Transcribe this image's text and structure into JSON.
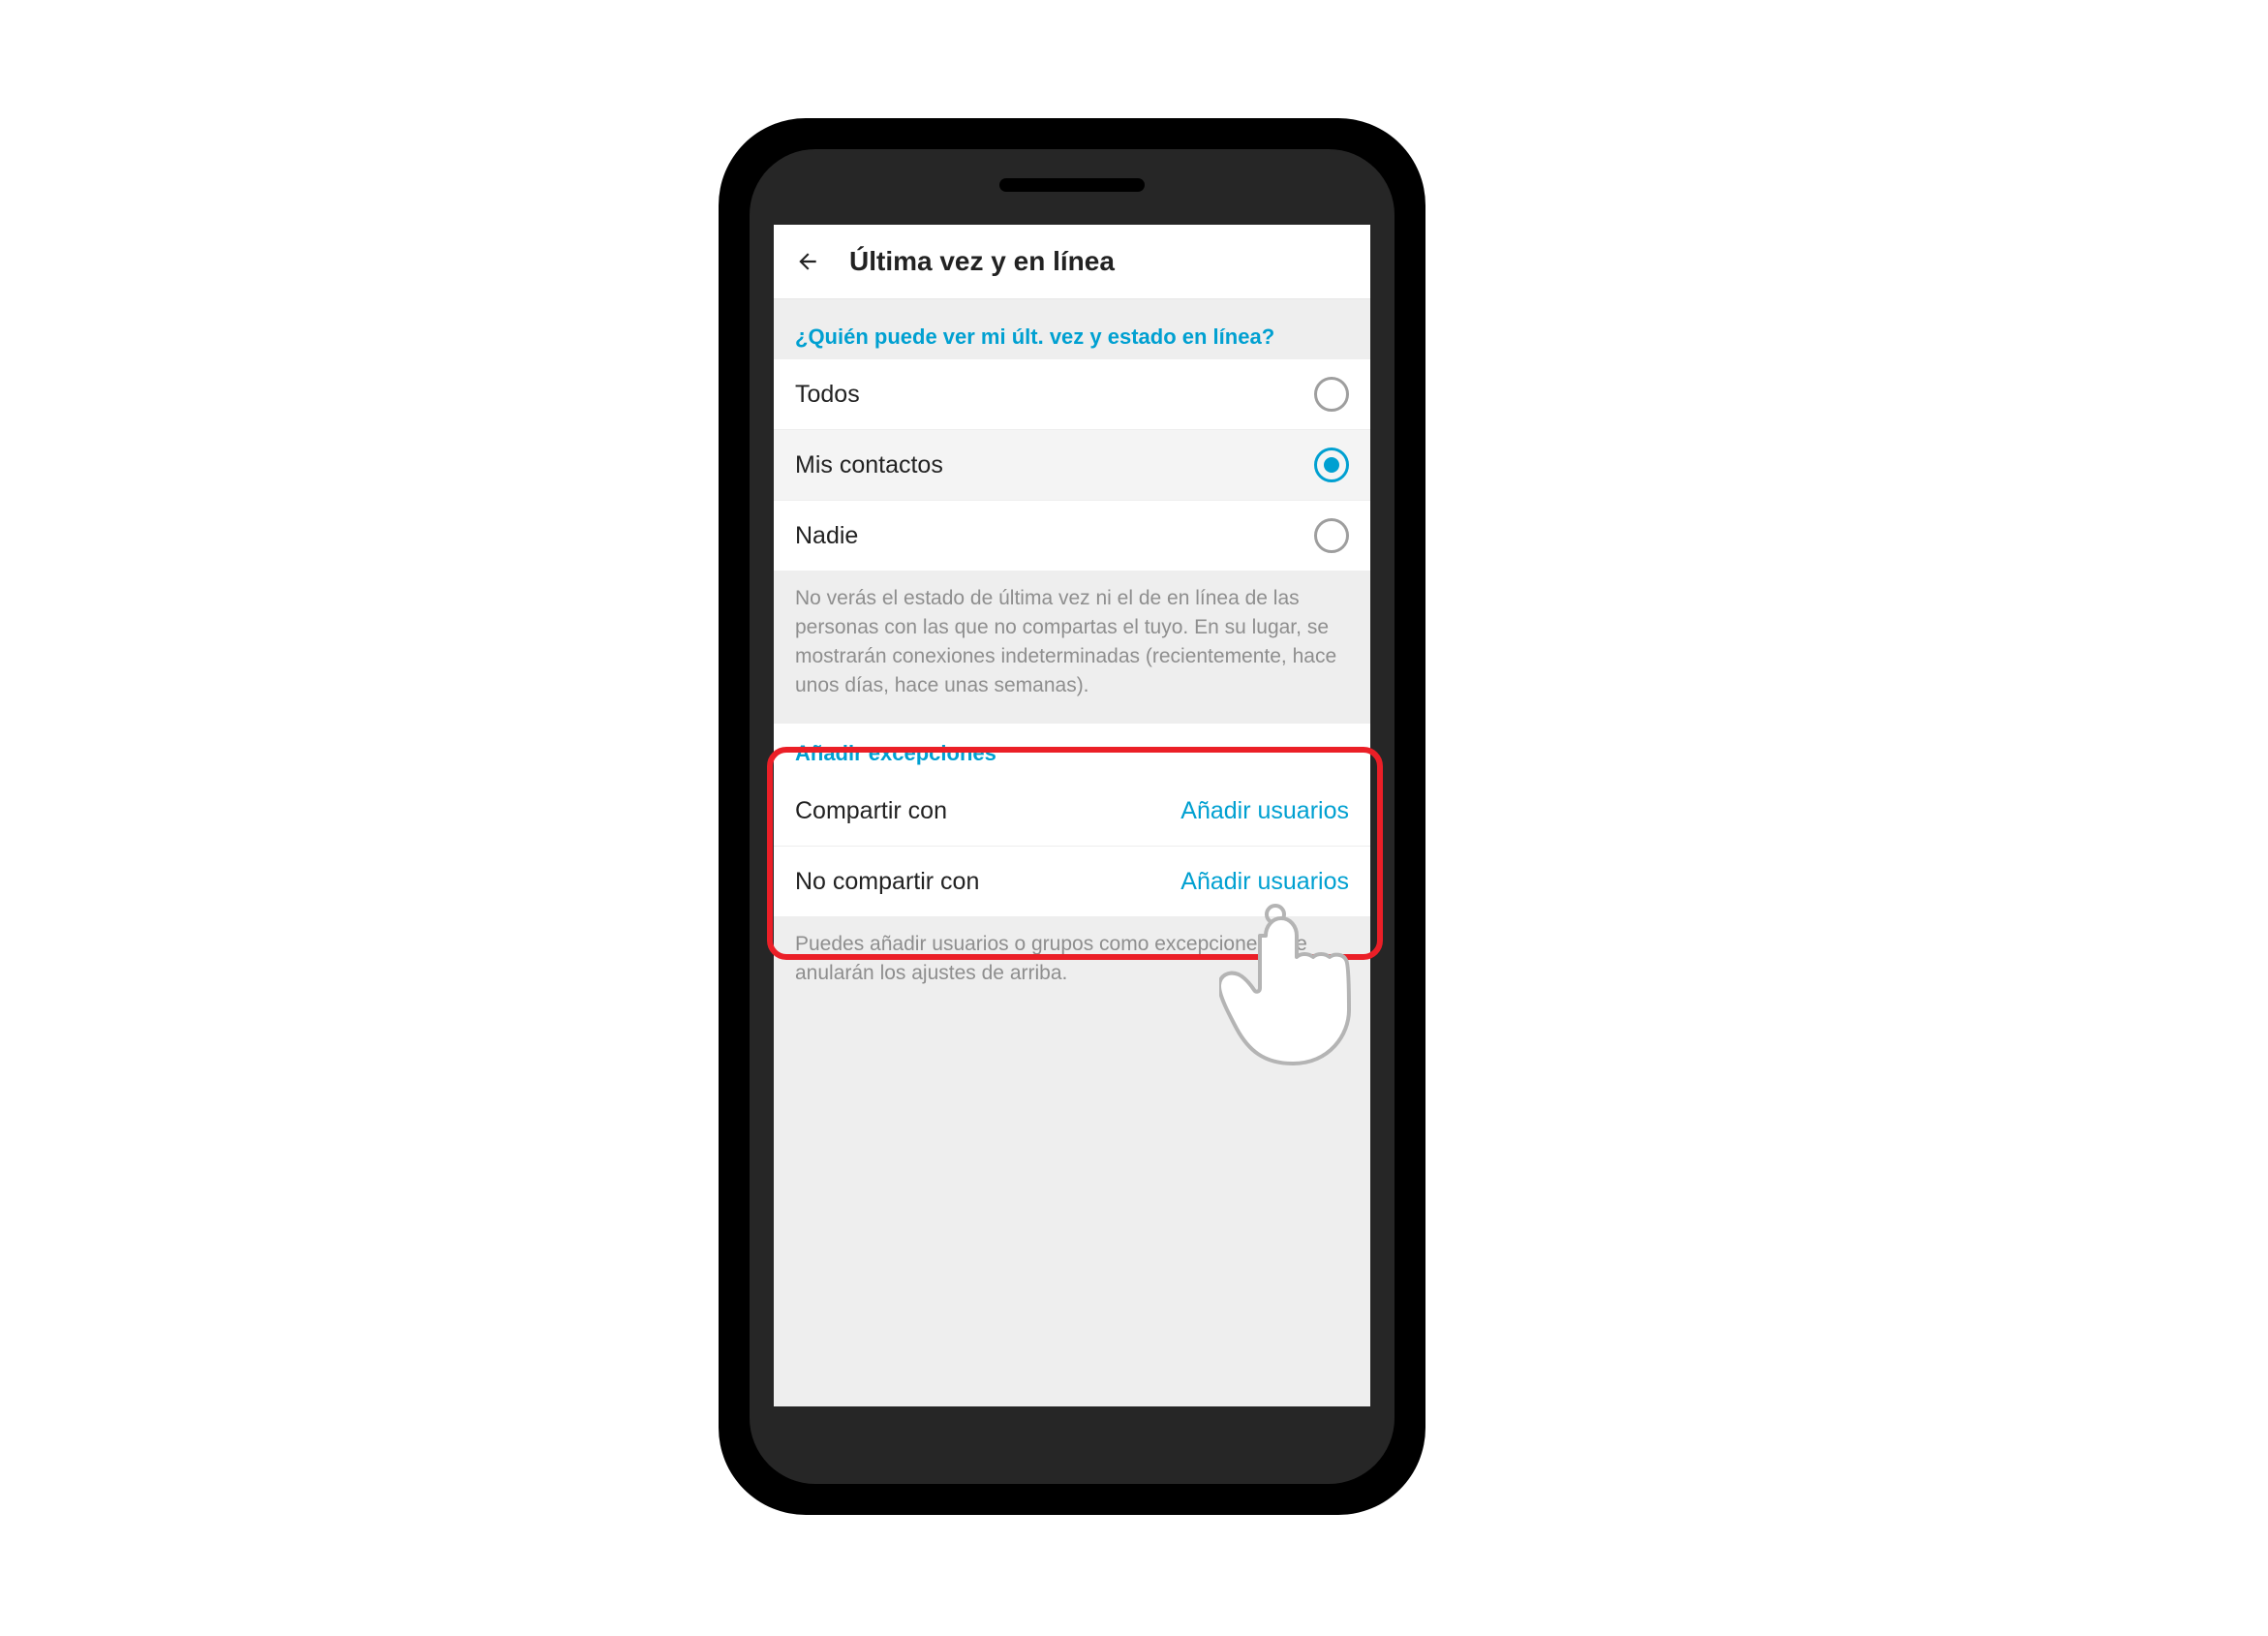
{
  "header": {
    "title": "Última vez y en línea"
  },
  "section1": {
    "title": "¿Quién puede ver mi últ. vez y estado en línea?",
    "options": [
      {
        "label": "Todos",
        "selected": false
      },
      {
        "label": "Mis contactos",
        "selected": true
      },
      {
        "label": "Nadie",
        "selected": false
      }
    ],
    "note": "No verás el estado de última vez ni el de en línea de las personas con las que no compartas el tuyo. En su lugar, se mostrarán conexiones indeterminadas (recientemente, hace unos días, hace unas semanas)."
  },
  "section2": {
    "title": "Añadir excepciones",
    "rows": [
      {
        "label": "Compartir con",
        "action": "Añadir usuarios"
      },
      {
        "label": "No compartir con",
        "action": "Añadir usuarios"
      }
    ],
    "note": "Puedes añadir usuarios o grupos como excepciones que anularán los ajustes de arriba."
  }
}
